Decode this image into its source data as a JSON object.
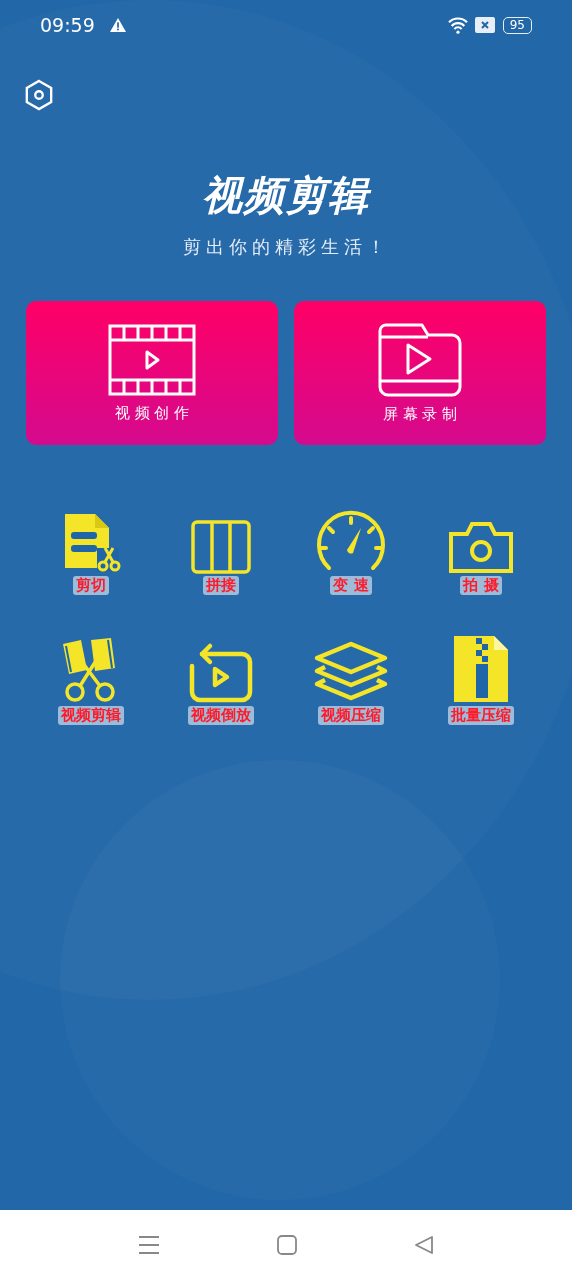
{
  "status_bar": {
    "time": "09:59",
    "battery": "95"
  },
  "header": {
    "title": "视频剪辑",
    "subtitle": "剪出你的精彩生活！"
  },
  "cards": [
    {
      "label": "视 频 创 作",
      "kind": "film"
    },
    {
      "label": "屏 幕 录 制",
      "kind": "folder"
    }
  ],
  "tools": [
    {
      "label": "剪切",
      "kind": "doc-scissors"
    },
    {
      "label": "拼接",
      "kind": "columns"
    },
    {
      "label": "变 速",
      "kind": "gauge"
    },
    {
      "label": "拍 摄",
      "kind": "camera"
    },
    {
      "label": "视频剪辑",
      "kind": "film-scissors"
    },
    {
      "label": "视频倒放",
      "kind": "replay"
    },
    {
      "label": "视频压缩",
      "kind": "layers"
    },
    {
      "label": "批量压缩",
      "kind": "zip"
    }
  ]
}
